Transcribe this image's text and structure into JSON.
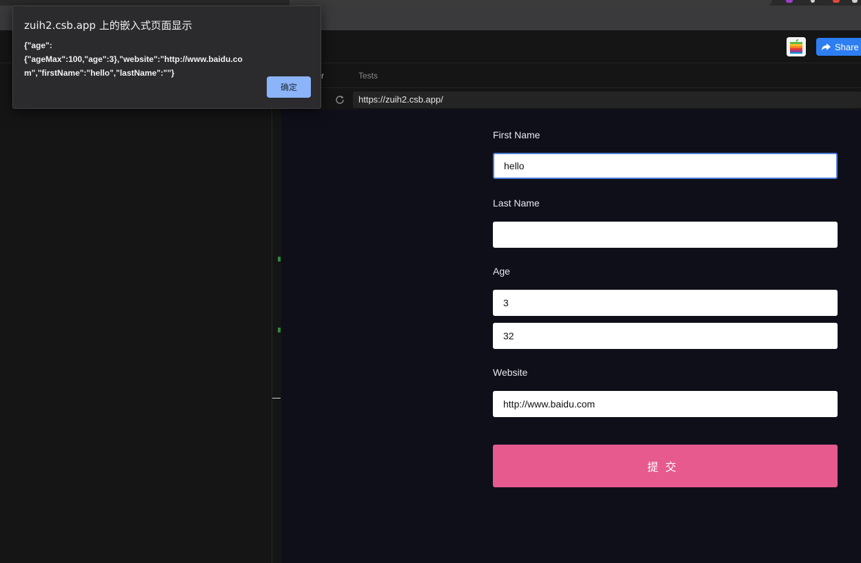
{
  "dialog": {
    "title": "zuih2.csb.app 上的嵌入式页面显示",
    "message": "{\"age\":{\"ageMax\":100,\"age\":3},\"website\":\"http://www.baidu.com\",\"firstName\":\"hello\",\"lastName\":\"\"}",
    "ok_label": "确定"
  },
  "header": {
    "share_label": "Share"
  },
  "preview_tabs": {
    "partial_tab_label": "r",
    "tests_label": "Tests"
  },
  "address_bar": {
    "url": "https://zuih2.csb.app/"
  },
  "form": {
    "first_name_label": "First Name",
    "first_name_value": "hello",
    "last_name_label": "Last Name",
    "last_name_value": "",
    "age_label": "Age",
    "age_value": "3",
    "age_max_value": "32",
    "website_label": "Website",
    "website_value": "http://www.baidu.com",
    "submit_label": "提交"
  },
  "colors": {
    "submit_button": "#e65a8d",
    "dialog_ok_button": "#8cb4f8",
    "share_button": "#2d7ef1",
    "preview_background": "#0f0f1a",
    "focus_border": "#4d7fd9"
  }
}
